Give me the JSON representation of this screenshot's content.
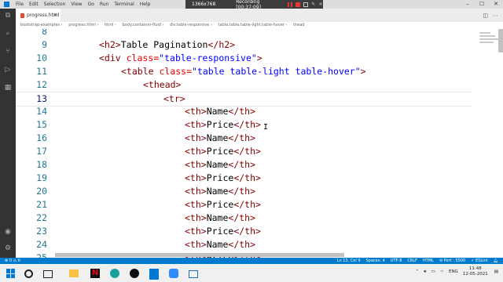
{
  "menu": [
    "File",
    "Edit",
    "Selection",
    "View",
    "Go",
    "Run",
    "Terminal",
    "Help"
  ],
  "recorder": {
    "resolution": "1366x768",
    "status": "Recording [00:37:09]"
  },
  "tab": {
    "label": "progress.html"
  },
  "breadcrumb": [
    "bootstrap-examples",
    "progress.html",
    "html",
    "body.container-fluid",
    "div.table-responsive",
    "table.table.table-light.table-hover",
    "thead"
  ],
  "code": {
    "line_numbers": [
      "8",
      "9",
      "10",
      "11",
      "12",
      "13",
      "14",
      "15",
      "16",
      "17",
      "18",
      "19",
      "20",
      "21",
      "22",
      "23",
      "24",
      "25"
    ],
    "h2_open": "<h2>",
    "h2_text": "Table Pagination",
    "h2_close": "</h2>",
    "div_open": "<div ",
    "div_class_attr": "class=",
    "div_class_val": "\"table-responsive\"",
    "div_close": ">",
    "table_open": "<table ",
    "table_class_attr": "class=",
    "table_class_val": "\"table table-light table-hover\"",
    "table_close": ">",
    "thead": "<thead>",
    "tr": "<tr>",
    "th_open": "<th>",
    "th_close": "</th>",
    "name": "Name",
    "price": "Price"
  },
  "statusbar": {
    "left": "⊗ 0 ⚠ 0",
    "items": [
      "Ln 13, Col 9",
      "Spaces: 4",
      "UTF-8",
      "CRLF",
      "HTML",
      "⊘ Port : 5500",
      "✓ ESLint"
    ]
  },
  "taskbar": {
    "lang": "ENG",
    "time": "11:48",
    "date": "12-05-2021"
  },
  "colors": {
    "status": "#007acc",
    "activity": "#333333",
    "tag": "#800000",
    "attr": "#e50000",
    "string": "#0000ff",
    "line_number": "#237893"
  }
}
